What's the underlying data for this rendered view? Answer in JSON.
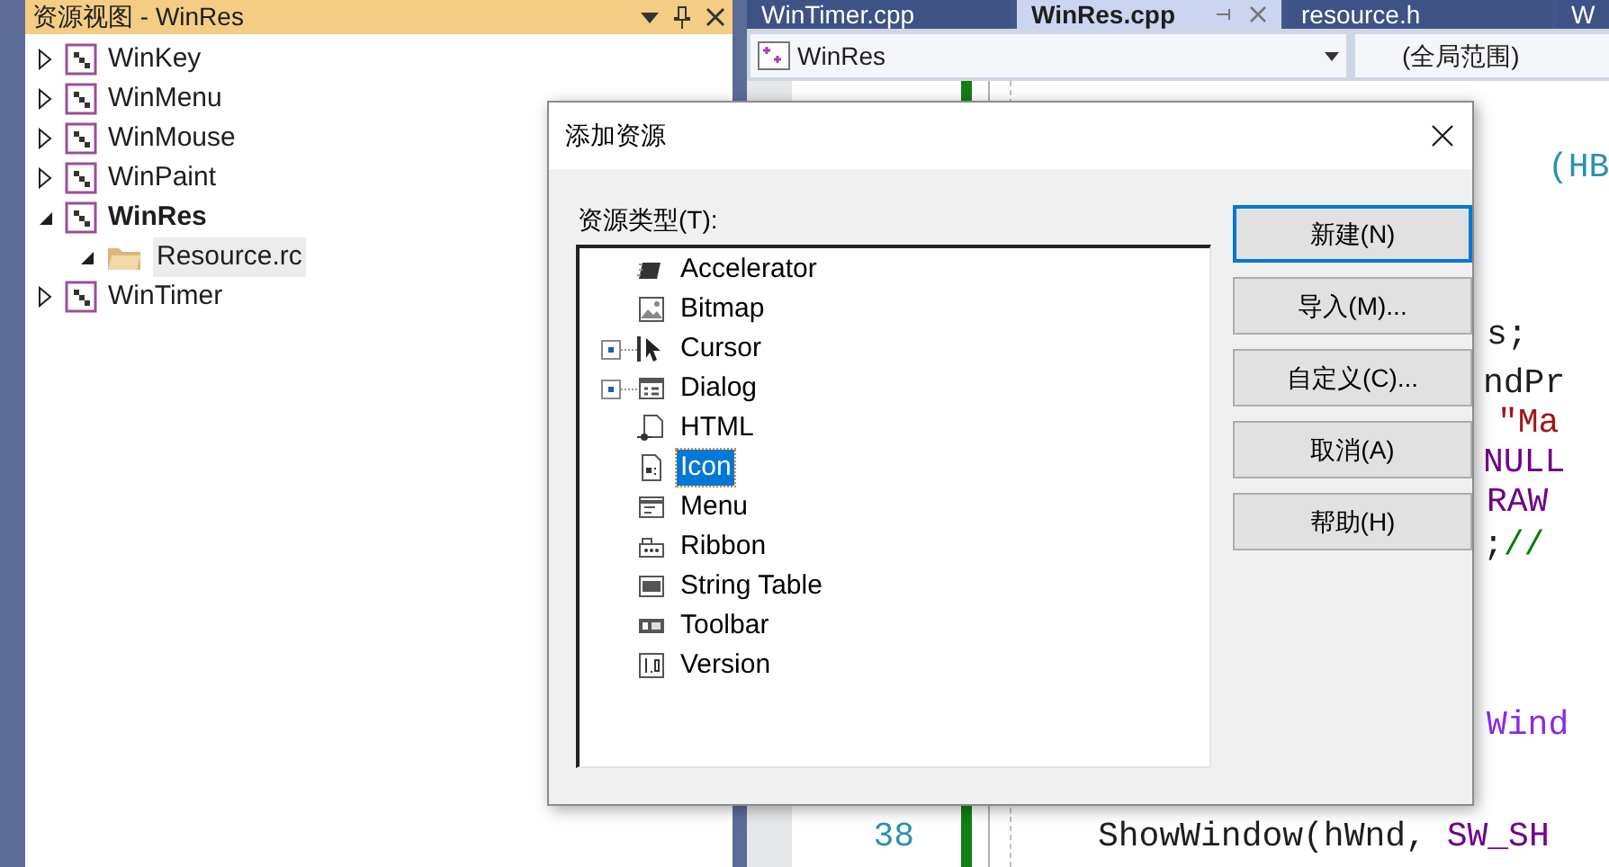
{
  "resource_view": {
    "title": "资源视图 - WinRes",
    "items": [
      {
        "label": "WinKey",
        "expanded": false,
        "startup": false
      },
      {
        "label": "WinMenu",
        "expanded": false,
        "startup": false
      },
      {
        "label": "WinMouse",
        "expanded": false,
        "startup": false
      },
      {
        "label": "WinPaint",
        "expanded": false,
        "startup": false
      },
      {
        "label": "WinRes",
        "expanded": true,
        "startup": true,
        "children": [
          {
            "label": "Resource.rc",
            "expanded": true,
            "selected": true
          }
        ]
      },
      {
        "label": "WinTimer",
        "expanded": false,
        "startup": false
      }
    ]
  },
  "editor": {
    "tabs": [
      {
        "label": "WinTimer.cpp",
        "selected": false
      },
      {
        "label": "WinRes.cpp",
        "selected": true
      },
      {
        "label": "resource.h",
        "selected": false
      },
      {
        "label": "W",
        "selected": false
      }
    ],
    "project_dropdown": "WinRes",
    "scope_dropdown": "(全局范围)",
    "lines": [
      {
        "tokens": [
          {
            "text": "(HB",
            "kind": "type"
          }
        ]
      },
      {
        "tokens": [
          {
            "text": "s;",
            "kind": "plain"
          }
        ]
      },
      {
        "tokens": [
          {
            "text": "ndPr",
            "kind": "plain"
          }
        ]
      },
      {
        "tokens": [
          {
            "text": "\"Ma",
            "kind": "string"
          }
        ]
      },
      {
        "tokens": [
          {
            "text": "NULL",
            "kind": "macro"
          }
        ]
      },
      {
        "tokens": [
          {
            "text": "RAW",
            "kind": "macro"
          }
        ]
      },
      {
        "tokens": [
          {
            "text": ";",
            "kind": "plain"
          },
          {
            "text": "//",
            "kind": "comment"
          }
        ]
      },
      {
        "tokens": [
          {
            "text": "Wind",
            "kind": "function"
          }
        ]
      },
      {
        "number": "38",
        "tokens": [
          {
            "text": "ShowWindow(hWnd, ",
            "kind": "plain"
          },
          {
            "text": "SW_SH",
            "kind": "macro"
          }
        ]
      }
    ]
  },
  "dialog": {
    "title": "添加资源",
    "list_label": "资源类型(T):",
    "resource_types": [
      {
        "label": "Accelerator",
        "selected": false,
        "expandable": false
      },
      {
        "label": "Bitmap",
        "selected": false,
        "expandable": false
      },
      {
        "label": "Cursor",
        "selected": false,
        "expandable": true
      },
      {
        "label": "Dialog",
        "selected": false,
        "expandable": true
      },
      {
        "label": "HTML",
        "selected": false,
        "expandable": false
      },
      {
        "label": "Icon",
        "selected": true,
        "expandable": false
      },
      {
        "label": "Menu",
        "selected": false,
        "expandable": false
      },
      {
        "label": "Ribbon",
        "selected": false,
        "expandable": false
      },
      {
        "label": "String Table",
        "selected": false,
        "expandable": false
      },
      {
        "label": "Toolbar",
        "selected": false,
        "expandable": false
      },
      {
        "label": "Version",
        "selected": false,
        "expandable": false
      }
    ],
    "buttons": [
      {
        "label": "新建(N)",
        "default": true
      },
      {
        "label": "导入(M)...",
        "default": false
      },
      {
        "label": "自定义(C)...",
        "default": false
      },
      {
        "label": "取消(A)",
        "default": false
      },
      {
        "label": "帮助(H)",
        "default": false
      }
    ]
  }
}
